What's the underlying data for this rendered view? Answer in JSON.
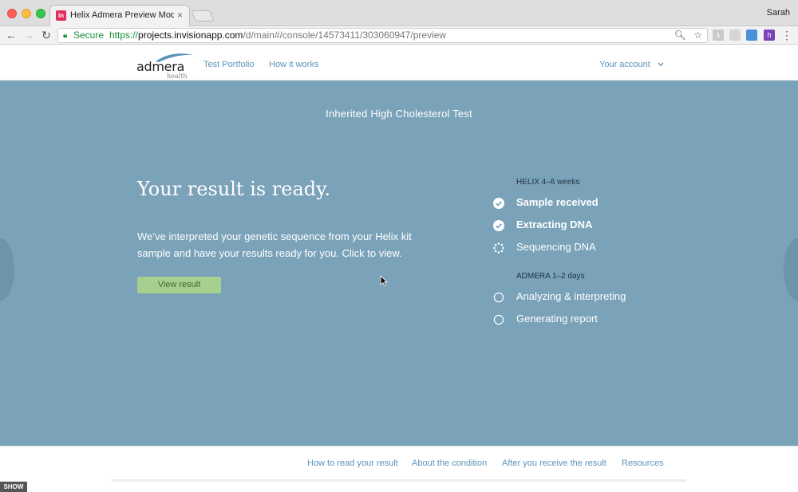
{
  "browser": {
    "tab_title": "Helix Admera Preview Mode - I",
    "tab_close": "×",
    "favicon_text": "in",
    "profile_name": "Sarah",
    "secure_label": "Secure",
    "url_protocol": "https://",
    "url_host": "projects.invisionapp.com",
    "url_path": "/d/main#/console/14573411/303060947/preview"
  },
  "header": {
    "logo_word": "admera",
    "logo_sub": "health",
    "nav": [
      "Test Portfolio",
      "How it works"
    ],
    "account_label": "Your account"
  },
  "hero": {
    "test_title": "Inherited High Cholesterol Test",
    "heading": "Your result is ready.",
    "body": "We’ve interpreted your genetic sequence from your Helix kit sample and have your results ready for you. Click to view.",
    "cta": "View result"
  },
  "progress": {
    "helix_label": "HELIX 4–6 weeks",
    "helix_steps": [
      {
        "label": "Sample received",
        "status": "done"
      },
      {
        "label": "Extracting DNA",
        "status": "done"
      },
      {
        "label": "Sequencing DNA",
        "status": "in-progress"
      }
    ],
    "admera_label": "ADMERA 1–2 days",
    "admera_steps": [
      {
        "label": "Analyzing & interpreting",
        "status": "pending"
      },
      {
        "label": "Generating report",
        "status": "pending"
      }
    ]
  },
  "subnav": {
    "links": [
      "How to read your result",
      "About the condition",
      "After you receive the result",
      "Resources"
    ]
  },
  "invision": {
    "show_label": "SHOW"
  },
  "colors": {
    "hero_bg": "#7aa2b8",
    "link": "#5b93b8",
    "cta_bg": "#a7cf8d"
  }
}
